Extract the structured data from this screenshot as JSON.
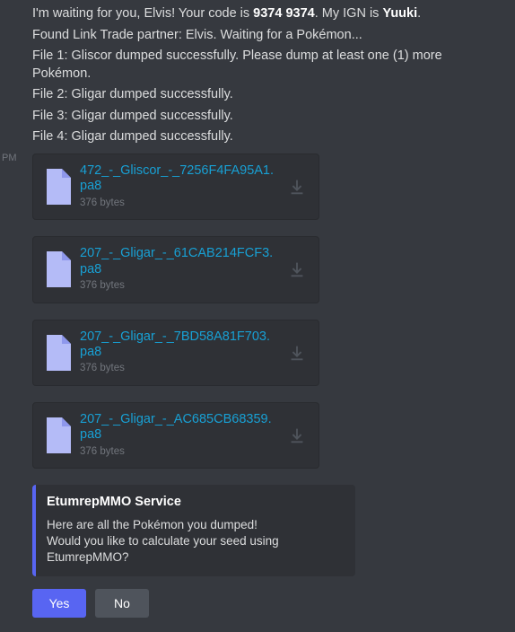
{
  "thumb_timestamp": "PM",
  "messages": {
    "line1_a": "I'm waiting for you, Elvis! Your code is ",
    "line1_code": "9374 9374",
    "line1_b": ". My IGN is ",
    "line1_ign": "Yuuki",
    "line1_c": ".",
    "line2": "Found Link Trade partner: Elvis. Waiting for a Pokémon...",
    "line3": "File 1: Gliscor dumped successfully. Please dump at least one (1) more Pokémon.",
    "line4": "File 2: Gligar dumped successfully.",
    "line5": "File 3: Gligar dumped successfully.",
    "line6": "File 4: Gligar dumped successfully."
  },
  "attachments": [
    {
      "name": "472_-_Gliscor_-_7256F4FA95A1.pa8",
      "size": "376 bytes"
    },
    {
      "name": "207_-_Gligar_-_61CAB214FCF3.pa8",
      "size": "376 bytes"
    },
    {
      "name": "207_-_Gligar_-_7BD58A81F703.pa8",
      "size": "376 bytes"
    },
    {
      "name": "207_-_Gligar_-_AC685CB68359.pa8",
      "size": "376 bytes"
    }
  ],
  "embed": {
    "title": "EtumrepMMO Service",
    "line1": "Here are all the Pokémon you dumped!",
    "line2": "Would you like to calculate your seed using EtumrepMMO?"
  },
  "buttons": {
    "yes": "Yes",
    "no": "No"
  }
}
